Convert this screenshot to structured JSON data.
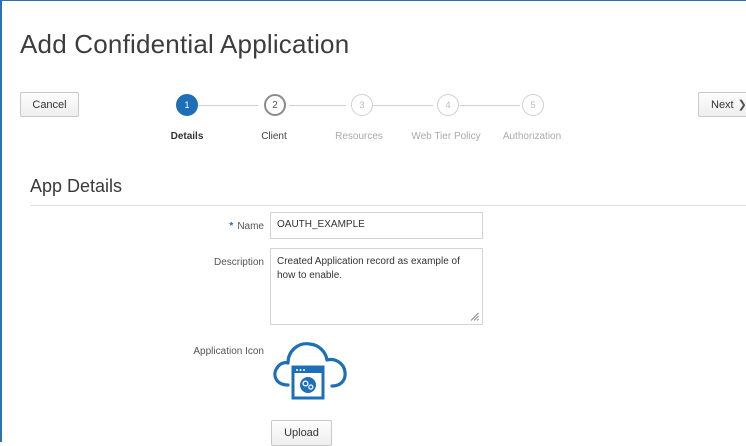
{
  "page": {
    "title": "Add Confidential Application"
  },
  "toolbar": {
    "cancel_label": "Cancel",
    "next_label": "Next"
  },
  "steps": [
    {
      "number": "1",
      "label": "Details"
    },
    {
      "number": "2",
      "label": "Client"
    },
    {
      "number": "3",
      "label": "Resources"
    },
    {
      "number": "4",
      "label": "Web Tier Policy"
    },
    {
      "number": "5",
      "label": "Authorization"
    }
  ],
  "section": {
    "title": "App Details"
  },
  "form": {
    "name_label": "Name",
    "name_value": "OAUTH_EXAMPLE",
    "required_marker": "*",
    "description_label": "Description",
    "description_value": "Created Application record as example of how to enable.",
    "icon_label": "Application Icon",
    "upload_label": "Upload"
  },
  "colors": {
    "accent": "#1d6fb8",
    "frame_border": "#2f6fb3"
  },
  "icons": {
    "app_icon": "cloud-app-icon",
    "next_chevron": "chevron-right-icon",
    "resize": "resize-grip-icon"
  }
}
